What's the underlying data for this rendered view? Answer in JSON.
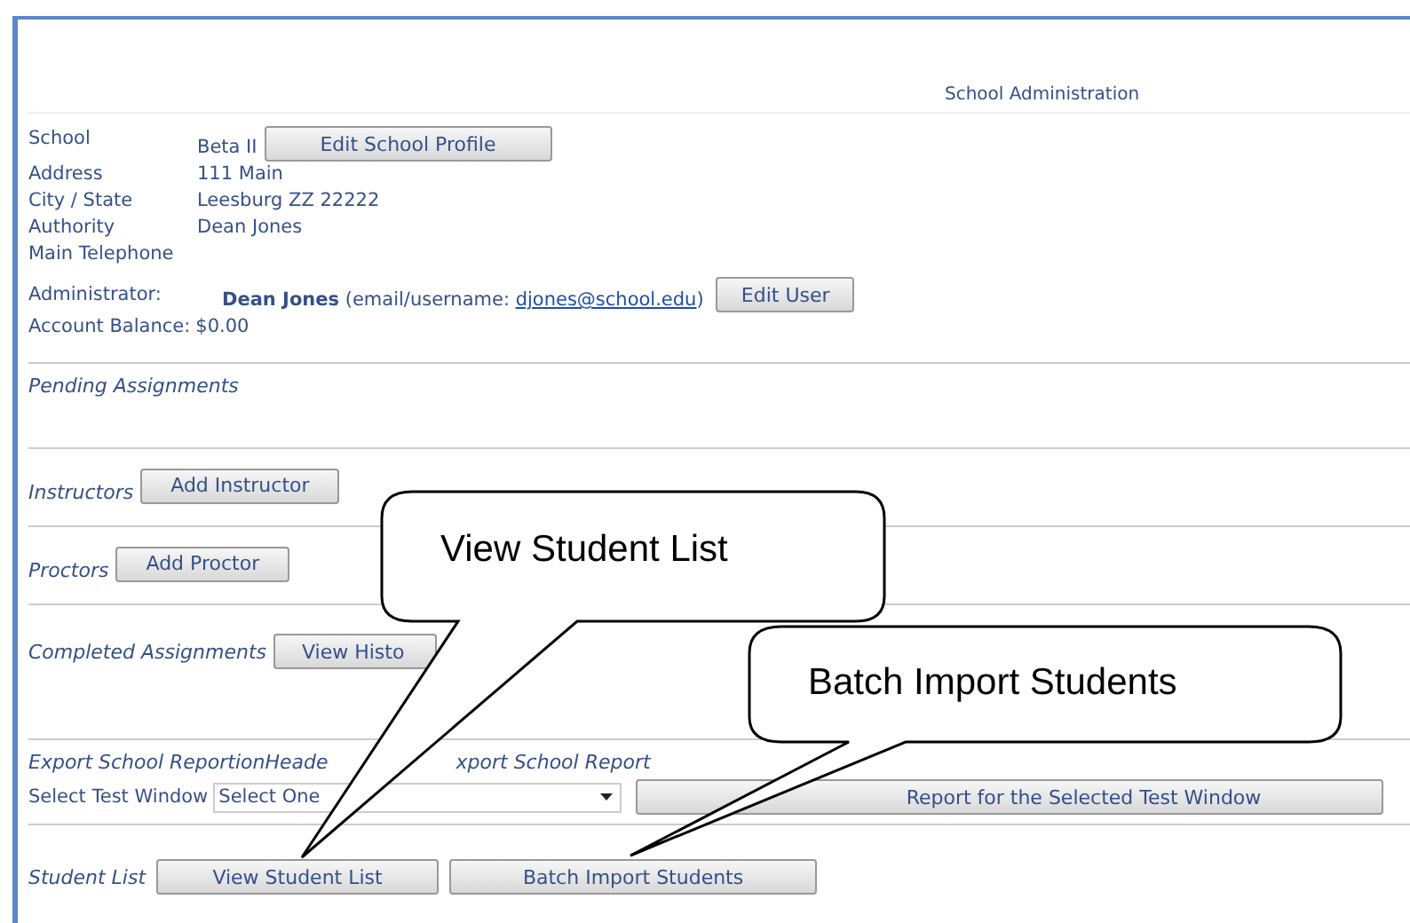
{
  "header": {
    "title": "School Administration"
  },
  "school_info": [
    {
      "label": "School",
      "value": "Beta II"
    },
    {
      "label": "Address",
      "value": "111 Main"
    },
    {
      "label": "City / State",
      "value": "Leesburg ZZ 22222"
    },
    {
      "label": "Authority",
      "value": "Dean Jones"
    },
    {
      "label": "Main Telephone"
    }
  ],
  "edit_profile_button": "Edit School Profile",
  "administrator": {
    "label": "Administrator:",
    "name": "Dean Jones",
    "email_prefix": "(email/username: ",
    "email": "djones@school.edu",
    "email_suffix": ")",
    "button": "Edit User"
  },
  "balance": {
    "label": "Account Balance:",
    "value": "$0.00"
  },
  "sections": [
    {
      "kind": "plain",
      "title": "Pending Assignments"
    },
    {
      "kind": "button",
      "title": "Instructors",
      "button": "Add Instructor"
    },
    {
      "kind": "button",
      "title": "Proctors",
      "button": "Add Proctor"
    },
    {
      "kind": "button",
      "title": "Completed Assignments",
      "button": "View Histo"
    }
  ],
  "export": {
    "heading_part_1": "Export School ReportionHeade",
    "heading_part_2": "xport School Report",
    "select_label": "Select Test Window",
    "select_value": "Select One",
    "button": "Report for the Selected Test Window"
  },
  "student_list": {
    "title": "Student List",
    "buttons": [
      "View Student List",
      "Batch Import Students"
    ]
  },
  "callouts": [
    {
      "text": "View Student List"
    },
    {
      "text": "Batch Import Students"
    }
  ]
}
